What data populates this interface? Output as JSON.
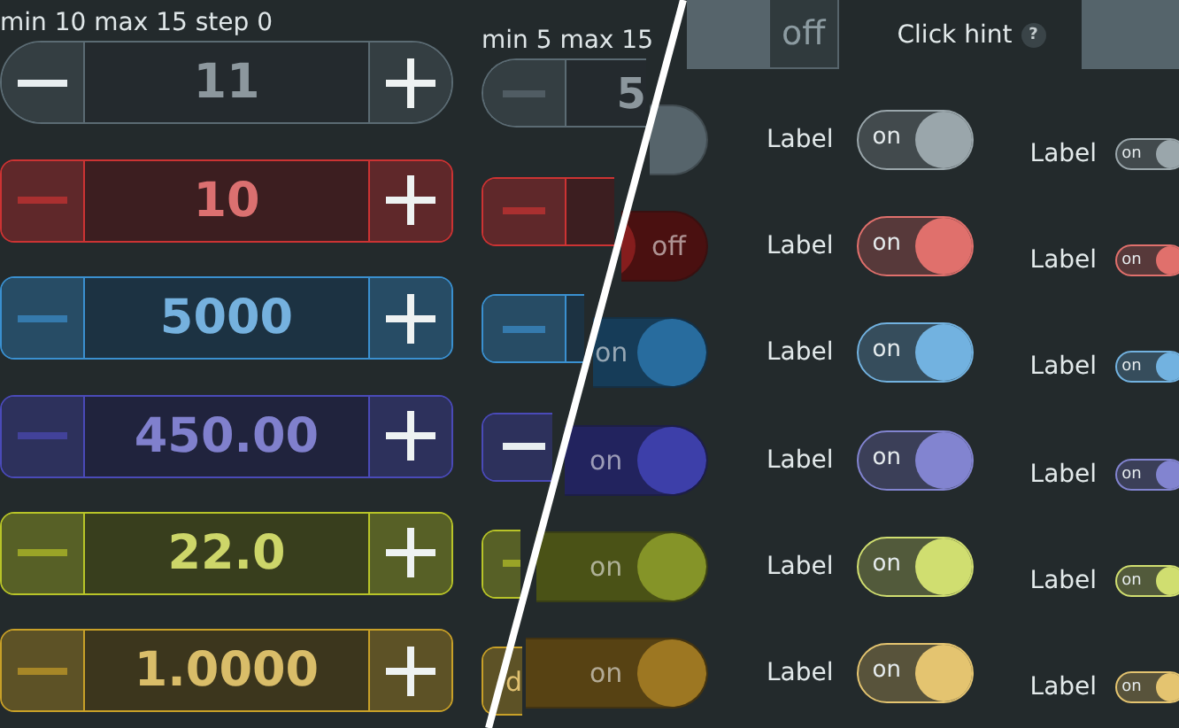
{
  "spinners": {
    "label": "min 10 max 15 step 0",
    "rows": [
      {
        "color": "#5b6b73",
        "value": "11",
        "minus_disabled": false
      },
      {
        "color": "#cc3333",
        "value": "10",
        "minus_disabled": true
      },
      {
        "color": "#3a90d0",
        "value": "5000",
        "minus_disabled": true
      },
      {
        "color": "#4a4ab8",
        "value": "450.00",
        "minus_disabled": true
      },
      {
        "color": "#b8c428",
        "value": "22.0",
        "minus_disabled": true
      },
      {
        "color": "#c8a028",
        "value": "1.0000",
        "minus_disabled": true
      }
    ]
  },
  "spinners_2": {
    "label": "min 5 max 15",
    "rows": [
      {
        "color": "#5b6b73",
        "value": "5",
        "minus_disabled": true
      },
      {
        "color": "#cc3333",
        "minus_disabled": true
      },
      {
        "color": "#3a90d0",
        "minus_disabled": true
      },
      {
        "color": "#4a4ab8",
        "minus_disabled": false
      },
      {
        "color": "#b8c428",
        "minus_disabled": true
      },
      {
        "color": "#c8a028",
        "button_text": "d"
      }
    ]
  },
  "top_bar": {
    "switch": {
      "label": "off",
      "on": false
    },
    "tab": {
      "label": "Click hint",
      "hint": "?"
    }
  },
  "large_switches": [
    {
      "color": "#56646b",
      "on": false
    },
    {
      "color": "#4a1010",
      "on": false,
      "text": "off"
    },
    {
      "color": "#163c58",
      "on": true,
      "text": "on"
    },
    {
      "color": "#22235e",
      "on": true,
      "text": "on"
    },
    {
      "color": "#4a5216",
      "on": true,
      "text": "on"
    },
    {
      "color": "#574213",
      "on": true,
      "text": "on"
    }
  ],
  "labeled_switches": [
    {
      "label": "Label",
      "color": "#9aa6ab",
      "on": true,
      "text": "on"
    },
    {
      "label": "Label",
      "color": "#e0706c",
      "on": true,
      "text": "on"
    },
    {
      "label": "Label",
      "color": "#72b2e0",
      "on": true,
      "text": "on"
    },
    {
      "label": "Label",
      "color": "#8284d0",
      "on": true,
      "text": "on"
    },
    {
      "label": "Label",
      "color": "#d0de70",
      "on": true,
      "text": "on"
    },
    {
      "label": "Label",
      "color": "#e4c470",
      "on": true,
      "text": "on"
    }
  ],
  "small_switches": [
    {
      "label": "Label",
      "color": "#9aa6ab",
      "on": true,
      "text": "on"
    },
    {
      "label": "Label",
      "color": "#e0706c",
      "on": true,
      "text": "on"
    },
    {
      "label": "Label",
      "color": "#72b2e0",
      "on": true,
      "text": "on"
    },
    {
      "label": "Label",
      "color": "#8284d0",
      "on": true,
      "text": "on"
    },
    {
      "label": "Label",
      "color": "#d0de70",
      "on": true,
      "text": "on"
    },
    {
      "label": "Label",
      "color": "#e4c470",
      "on": true,
      "text": "on"
    }
  ]
}
